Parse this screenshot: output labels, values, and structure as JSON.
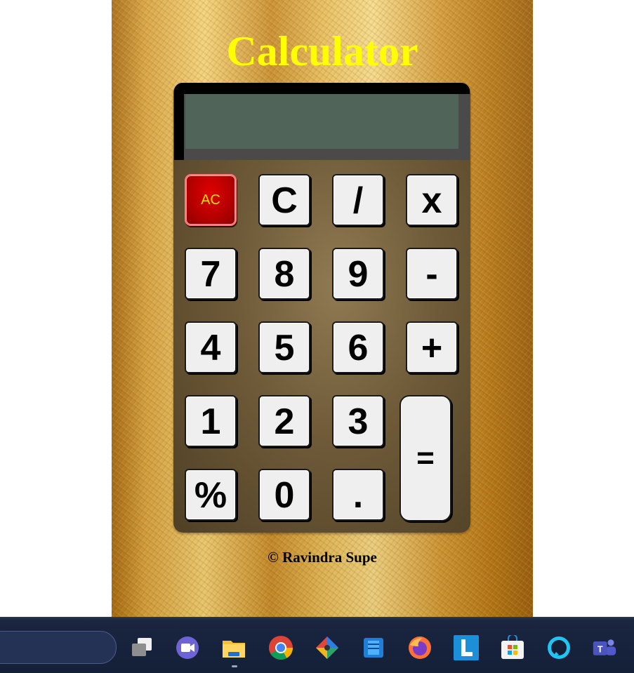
{
  "app": {
    "title": "Calculator",
    "display_value": "",
    "copyright": "© Ravindra Supe"
  },
  "keys": {
    "ac": "AC",
    "clear": "C",
    "divide": "/",
    "multiply": "x",
    "seven": "7",
    "eight": "8",
    "nine": "9",
    "minus": "-",
    "four": "4",
    "five": "5",
    "six": "6",
    "plus": "+",
    "one": "1",
    "two": "2",
    "three": "3",
    "equals": "=",
    "percent": "%",
    "zero": "0",
    "dot": "."
  },
  "colors": {
    "title": "#ffff00",
    "display": "#51645a",
    "ac_button": "#c00000",
    "ac_text": "#f5e000",
    "key_face": "#efefef"
  },
  "taskbar": {
    "icons": [
      "task-view-icon",
      "chat-icon",
      "file-explorer-icon",
      "chrome-icon",
      "snip-tool-icon",
      "archive-app-icon",
      "firefox-icon",
      "l-app-icon",
      "microsoft-store-icon",
      "alexa-icon",
      "teams-icon"
    ]
  }
}
